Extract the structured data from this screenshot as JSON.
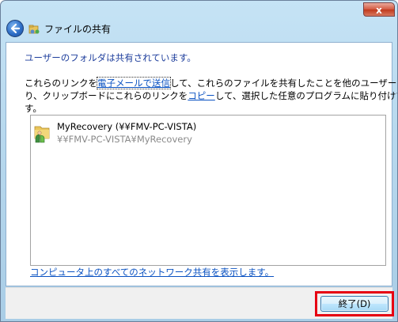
{
  "window": {
    "title": "ファイルの共有",
    "close_label": "x"
  },
  "content": {
    "heading": "ユーザーのフォルダは共有されています。",
    "desc_part1": "これらのリンクを",
    "email_link": "電子メールで送信",
    "desc_part2": "して、これらのファイルを共有したことを他のユーザーに通知した",
    "desc_part3": "り、クリップボードにこれらのリンクを",
    "copy_link": "コピー",
    "desc_part4": "して、選択した任意のプログラムに貼り付けてできま",
    "desc_part5": "す。"
  },
  "shared_items": [
    {
      "name": "MyRecovery (¥¥FMV-PC-VISTA)",
      "path": "¥¥FMV-PC-VISTA¥MyRecovery",
      "icon": "shared-folder-icon"
    }
  ],
  "show_all_link": "コンピュータ上のすべてのネットワーク共有を表示します。",
  "footer": {
    "finish_label": "終了(D)"
  },
  "colors": {
    "heading": "#1e3e9c",
    "link": "#0a52c2",
    "highlight": "#e60012",
    "path_text": "#8a8a8a"
  }
}
